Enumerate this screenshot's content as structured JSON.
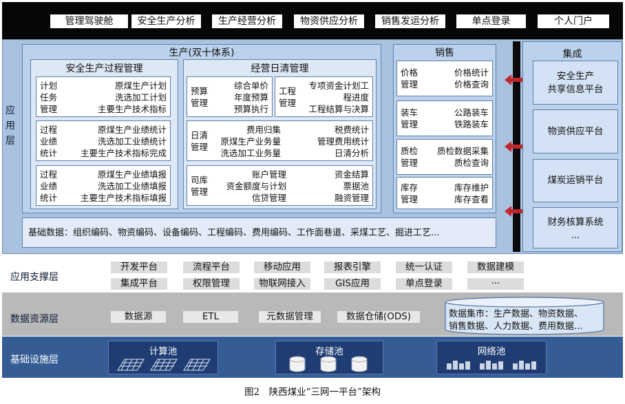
{
  "portal": {
    "items": [
      "管理驾驶舱",
      "安全生产分析",
      "生产经营分析",
      "物资供应分析",
      "销售发运分析",
      "单点登录",
      "个人门户"
    ]
  },
  "app": {
    "label": "应用层",
    "production": {
      "title": "生产(双十体系)",
      "safety": {
        "title": "安全生产过程管理",
        "box1": {
          "left": [
            "计划",
            "任务",
            "管理"
          ],
          "right": [
            "原煤生产计划",
            "洗选加工计划",
            "主要生产技术指标"
          ]
        },
        "box2": {
          "left": [
            "过程",
            "业绩",
            "统计"
          ],
          "right": [
            "原煤生产业绩统计",
            "洗选加工业绩统计",
            "主要生产技术指标完成"
          ]
        },
        "box3": {
          "left": [
            "过程",
            "业绩",
            "统计"
          ],
          "right": [
            "原煤生产业绩填报",
            "洗选加工业绩填报",
            "主要生产技术指标填报"
          ]
        }
      },
      "daily": {
        "title": "经营日清管理",
        "budget": {
          "left": [
            "预算",
            "管理"
          ],
          "right": [
            "综合单价",
            "年度预算",
            "预算执行"
          ]
        },
        "project": {
          "left": [
            "工程",
            "管理"
          ],
          "right": [
            "专项资金计划工",
            "程进度",
            "工程结算与决算"
          ]
        },
        "dayclear": {
          "left": [
            "日清",
            "管理"
          ],
          "mid": [
            "费用归集",
            "原煤生产业务量",
            "洗选加工业务量"
          ],
          "right": [
            "税费统计",
            "管理费用统计",
            "日清分析"
          ]
        },
        "treasury": {
          "left": [
            "司库",
            "管理"
          ],
          "mid": [
            "账户管理",
            "资金额度与计划",
            "信贷管理"
          ],
          "right": [
            "资金结算",
            "票据池",
            "融资管理"
          ]
        }
      }
    },
    "sales": {
      "title": "销售",
      "items": [
        {
          "left": [
            "价格",
            "管理"
          ],
          "right": [
            "价格统计",
            "价格查询"
          ]
        },
        {
          "left": [
            "装车",
            "管理"
          ],
          "right": [
            "公路装车",
            "铁路装车"
          ]
        },
        {
          "left": [
            "质检",
            "管理"
          ],
          "right": [
            "质检数据采集",
            "质检查询"
          ]
        },
        {
          "left": [
            "库存",
            "管理"
          ],
          "right": [
            "库存维护",
            "库存查看"
          ]
        }
      ]
    },
    "basic": "基础数据：组织编码、物资编码、设备编码、工程编码、费用编码、工作面巷道、采煤工艺、掘进工艺...",
    "integration": {
      "title": "集成",
      "items": [
        "安全生产\n共享信息平台",
        "物资供应平台",
        "煤炭运销平台",
        "财务核算系统\n..."
      ]
    },
    "arrow_color": "#c0262d"
  },
  "support": {
    "label": "应用支撑层",
    "row1": [
      "开发平台",
      "流程平台",
      "移动应用",
      "报表引擎",
      "统一认证",
      "数据建模"
    ],
    "row2": [
      "集成平台",
      "权限管理",
      "物联网接入",
      "GIS应用",
      "单点登录",
      "···"
    ]
  },
  "data": {
    "label": "数据资源层",
    "items": [
      "数据源",
      "ETL",
      "元数据管理",
      "数据仓储(ODS)"
    ],
    "mart": "数据集市：生产数据、物资数据、\n销售数据、人力数据、费用数据..."
  },
  "infra": {
    "label": "基础设施层",
    "pools": [
      "计算池",
      "存储池",
      "网络池"
    ]
  },
  "caption": "图2　陕西煤业“三网一平台”架构"
}
